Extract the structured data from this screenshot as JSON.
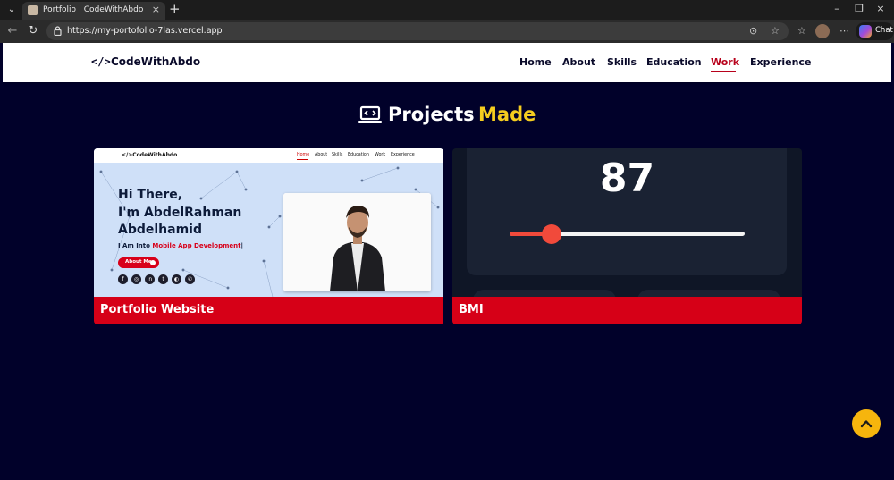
{
  "browser": {
    "tab_title": "Portfolio | CodeWithAbdo",
    "url": "https://my-portofolio-7las.vercel.app",
    "chat_label": "Chat"
  },
  "site": {
    "logo_icon": "</>",
    "logo_text": "CodeWithAbdo",
    "nav": [
      {
        "label": "Home",
        "active": false
      },
      {
        "label": "About",
        "active": false
      },
      {
        "label": "Skills",
        "active": false
      },
      {
        "label": "Education",
        "active": false
      },
      {
        "label": "Work",
        "active": true
      },
      {
        "label": "Experience",
        "active": false
      }
    ],
    "heading": {
      "main": "Projects",
      "accent": "Made",
      "icon": "laptop-code-icon"
    },
    "projects": [
      {
        "title": "Portfolio Website",
        "preview": {
          "logo": "</>CodeWithAbdo",
          "nav": [
            "Home",
            "About",
            "Skills",
            "Education",
            "Work",
            "Experience"
          ],
          "hero_lines": [
            "Hi There,",
            "I'm AbdelRahman",
            "Abdelhamid"
          ],
          "sub_prefix": "I Am Into ",
          "sub_accent": "Mobile App Development",
          "sub_suffix": "|",
          "button_label": "About Me",
          "social_icons": [
            "facebook-icon",
            "instagram-icon",
            "linkedin-icon",
            "twitter-icon",
            "github-icon",
            "whatsapp-icon"
          ]
        }
      },
      {
        "title": "BMI",
        "preview": {
          "value": "87",
          "slider_fraction": 0.18
        }
      }
    ]
  },
  "colors": {
    "page_bg": "#01012a",
    "accent_red": "#d60017",
    "accent_yellow": "#f5cd1f",
    "scroll_button": "#f6b50d"
  },
  "scroll_top": {
    "icon": "chevron-up-icon"
  }
}
